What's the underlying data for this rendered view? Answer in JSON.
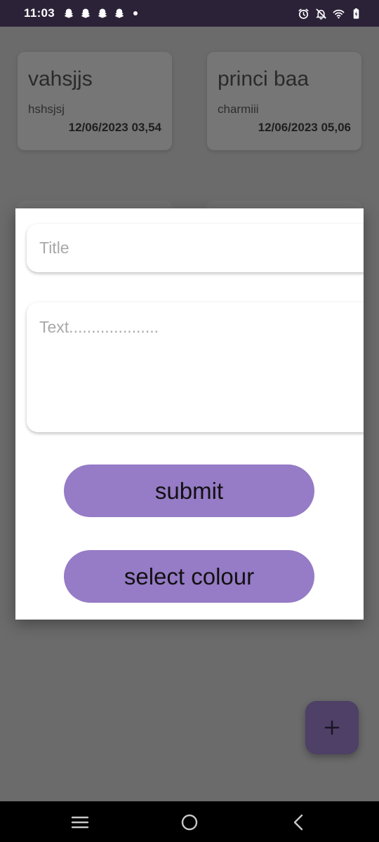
{
  "status_bar": {
    "time": "11:03",
    "notification_icons": [
      "snapchat-icon",
      "snapchat-icon",
      "snapchat-icon",
      "snapchat-icon"
    ],
    "system_icons": [
      "alarm-icon",
      "notifications-off-icon",
      "wifi-icon",
      "battery-charging-icon"
    ]
  },
  "notes": [
    {
      "title": "vahsjjs",
      "text": "hshsjsj",
      "date": "12/06/2023 03,54"
    },
    {
      "title": "princi baa",
      "text": "charmiii",
      "date": "12/06/2023 05,06"
    }
  ],
  "dialog": {
    "title_placeholder": "Title",
    "text_placeholder": "Text....................",
    "submit_label": "submit",
    "select_colour_label": "select colour"
  },
  "fab": {
    "icon": "plus-icon"
  },
  "nav_bar": {
    "icons": [
      "recents-icon",
      "home-icon",
      "back-icon"
    ]
  },
  "colors": {
    "status_bar_bg": "#2b2238",
    "dim_background": "#6b6b6b",
    "button_accent": "#967bc6",
    "fab_bg": "#4e4066",
    "dialog_bg": "#ffffff"
  }
}
